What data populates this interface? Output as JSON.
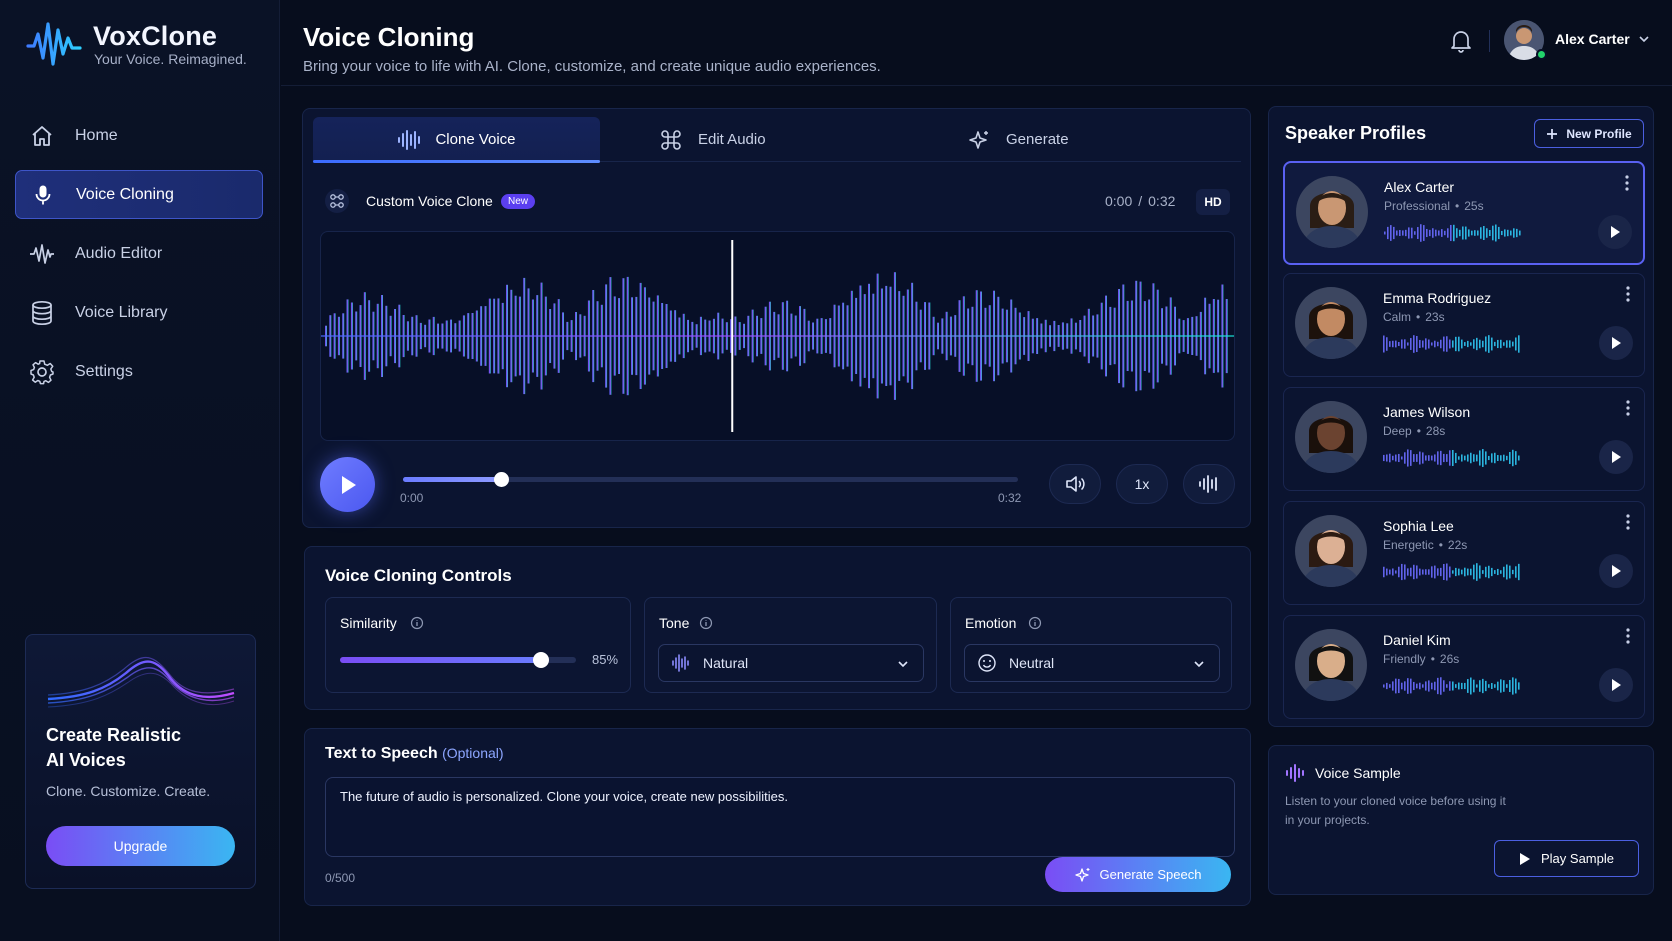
{
  "app": {
    "name": "VoxClone",
    "tagline": "Your Voice. Reimagined."
  },
  "sidebar": {
    "items": [
      {
        "label": "Home",
        "icon": "home-icon"
      },
      {
        "label": "Voice Cloning",
        "icon": "microphone-icon",
        "active": true
      },
      {
        "label": "Audio Editor",
        "icon": "waveform-icon"
      },
      {
        "label": "Voice Library",
        "icon": "database-icon"
      },
      {
        "label": "Settings",
        "icon": "gear-icon"
      }
    ],
    "promo": {
      "title_line1": "Create Realistic",
      "title_line2": "AI Voices",
      "subtitle": "Clone. Customize. Create.",
      "button": "Upgrade"
    }
  },
  "header": {
    "title": "Voice Cloning",
    "subtitle": "Bring your voice to life with AI. Clone, customize, and create unique audio experiences.",
    "user_name": "Alex Carter"
  },
  "tabs": [
    {
      "label": "Clone Voice",
      "icon": "waveform-icon",
      "active": true
    },
    {
      "label": "Edit Audio",
      "icon": "command-icon"
    },
    {
      "label": "Generate",
      "icon": "sparkle-icon"
    }
  ],
  "player": {
    "clip_name": "Custom Voice Clone",
    "badge": "New",
    "time_current": "0:00",
    "time_separator": "/",
    "time_total": "0:32",
    "quality": "HD",
    "seek_start": "0:00",
    "seek_end": "0:32",
    "progress": 0.16,
    "speed": "1x",
    "colors": {
      "start": "#4a6bff",
      "mid": "#9b4dff",
      "end": "#19e3d8"
    }
  },
  "controls": {
    "title": "Voice Cloning Controls",
    "similarity": {
      "label": "Similarity",
      "value_text": "85%",
      "value": 0.85
    },
    "tone": {
      "label": "Tone",
      "selected": "Natural"
    },
    "emotion": {
      "label": "Emotion",
      "selected": "Neutral"
    }
  },
  "tts": {
    "title": "Text to Speech",
    "optional": "(Optional)",
    "text": "The future of audio is personalized. Clone your voice, create new possibilities.",
    "counter": "0/500",
    "button": "Generate Speech"
  },
  "profiles": {
    "title": "Speaker Profiles",
    "new_button": "New Profile",
    "items": [
      {
        "name": "Alex Carter",
        "style": "Professional",
        "sep": "•",
        "duration": "25s",
        "selected": true,
        "skin": "#c99773",
        "hair": "#2a1d15"
      },
      {
        "name": "Emma Rodriguez",
        "style": "Calm",
        "sep": "•",
        "duration": "23s",
        "skin": "#c28a63",
        "hair": "#1d120c"
      },
      {
        "name": "James Wilson",
        "style": "Deep",
        "sep": "•",
        "duration": "28s",
        "skin": "#6b4330",
        "hair": "#1a100b"
      },
      {
        "name": "Sophia Lee",
        "style": "Energetic",
        "sep": "•",
        "duration": "22s",
        "skin": "#dcb094",
        "hair": "#2b1a12"
      },
      {
        "name": "Daniel Kim",
        "style": "Friendly",
        "sep": "•",
        "duration": "26s",
        "skin": "#d9ae8a",
        "hair": "#111111"
      }
    ]
  },
  "sample": {
    "title": "Voice Sample",
    "description_line1": "Listen to your cloned voice before using it",
    "description_line2": "in your projects.",
    "button": "Play Sample"
  }
}
